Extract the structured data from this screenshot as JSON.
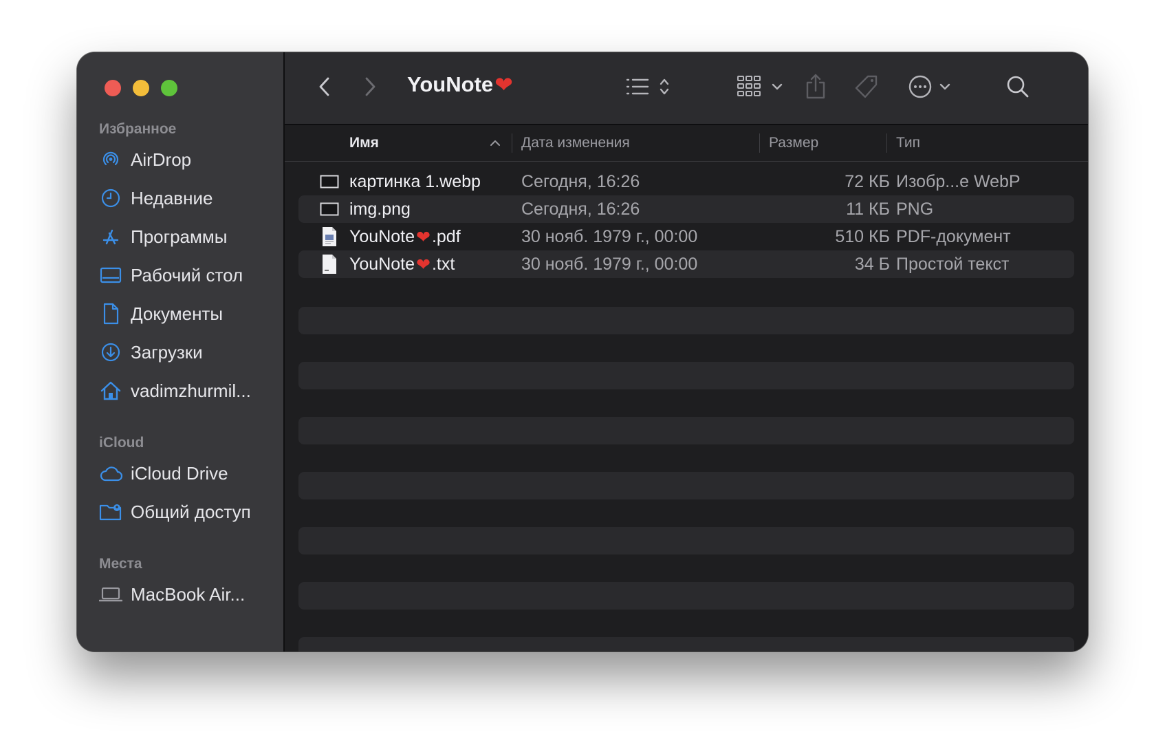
{
  "window": {
    "title": "YouNote",
    "title_emoji": "❤"
  },
  "colors": {
    "accent": "#3b8fe8",
    "close": "#ee5c55",
    "minimize": "#f3bd3a",
    "zoom": "#5fc43b",
    "heart": "#e3342f"
  },
  "sidebar": {
    "sections": [
      {
        "title": "Избранное",
        "items": [
          {
            "label": "AirDrop",
            "icon": "airdrop-icon"
          },
          {
            "label": "Недавние",
            "icon": "clock-icon"
          },
          {
            "label": "Программы",
            "icon": "applications-icon"
          },
          {
            "label": "Рабочий стол",
            "icon": "desktop-icon"
          },
          {
            "label": "Документы",
            "icon": "document-icon"
          },
          {
            "label": "Загрузки",
            "icon": "downloads-icon"
          },
          {
            "label": "vadimzhurmil...",
            "icon": "home-icon"
          }
        ]
      },
      {
        "title": "iCloud",
        "items": [
          {
            "label": "iCloud Drive",
            "icon": "cloud-icon"
          },
          {
            "label": "Общий доступ",
            "icon": "shared-folder-icon"
          }
        ]
      },
      {
        "title": "Места",
        "items": [
          {
            "label": "MacBook Air...",
            "icon": "laptop-icon"
          }
        ]
      }
    ]
  },
  "columns": {
    "name": "Имя",
    "date": "Дата изменения",
    "size": "Размер",
    "kind": "Тип"
  },
  "files": [
    {
      "name": "картинка 1.webp",
      "name_suffix": "",
      "date": "Сегодня, 16:26",
      "size": "72 КБ",
      "kind": "Изобр...e WebP",
      "icon": "image-file-icon"
    },
    {
      "name": "img.png",
      "name_suffix": "",
      "date": "Сегодня, 16:26",
      "size": "11 КБ",
      "kind": "PNG",
      "icon": "image-file-icon"
    },
    {
      "name": "YouNote",
      "name_suffix": ".pdf",
      "date": "30 нояб. 1979 г., 00:00",
      "size": "510 КБ",
      "kind": "PDF-документ",
      "icon": "pdf-file-icon"
    },
    {
      "name": "YouNote",
      "name_suffix": ".txt",
      "date": "30 нояб. 1979 г., 00:00",
      "size": "34 Б",
      "kind": "Простой текст",
      "icon": "txt-file-icon"
    }
  ]
}
